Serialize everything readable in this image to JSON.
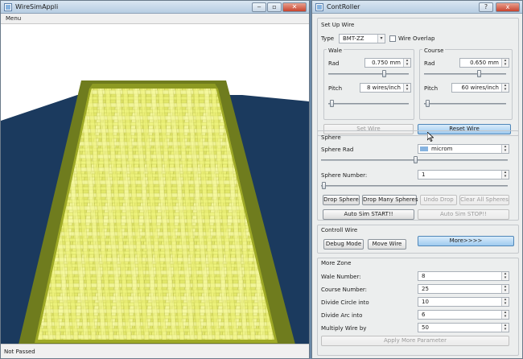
{
  "sim_window": {
    "title": "WireSimAppli",
    "menu": "Menu",
    "status": "Not Passed"
  },
  "controller": {
    "title": "ContRoller",
    "help_glyph": "?",
    "close_glyph": "x",
    "setup": {
      "heading": "Set Up Wire",
      "type_label": "Type",
      "type_value": "BMT-ZZ",
      "overlap_label": "Wire Overlap",
      "wale": {
        "heading": "Wale",
        "rad_label": "Rad",
        "rad_value": "0.750 mm",
        "pitch_label": "Pitch",
        "pitch_value": "8 wires/inch"
      },
      "course": {
        "heading": "Course",
        "rad_label": "Rad",
        "rad_value": "0.650 mm",
        "pitch_label": "Pitch",
        "pitch_value": "60 wires/inch"
      },
      "set_wire": "Set Wire",
      "reset_wire": "Reset Wire"
    },
    "sphere": {
      "heading": "Sphere",
      "rad_label": "Sphere Rad",
      "rad_unit": "microm",
      "number_label": "Sphere Number:",
      "number_value": "1",
      "drop_sphere": "Drop Sphere",
      "drop_many": "Drop Many Spheres",
      "undo_drop": "Undo Drop",
      "clear_all": "Clear All Spheres",
      "auto_start": "Auto Sim START!!",
      "auto_stop": "Auto Sim STOP!!"
    },
    "controll": {
      "heading": "Controll Wire",
      "debug": "Debug Mode",
      "move_wire": "Move Wire",
      "more": "More>>>>"
    },
    "more_zone": {
      "heading": "More Zone",
      "rows": [
        {
          "label": "Wale Number:",
          "value": "8"
        },
        {
          "label": "Course Number:",
          "value": "25"
        },
        {
          "label": "Divide Circle into",
          "value": "10"
        },
        {
          "label": "Divide Arc into",
          "value": "6"
        },
        {
          "label": "Multiply Wire by",
          "value": "50"
        }
      ],
      "apply": "Apply More Parameter"
    }
  }
}
